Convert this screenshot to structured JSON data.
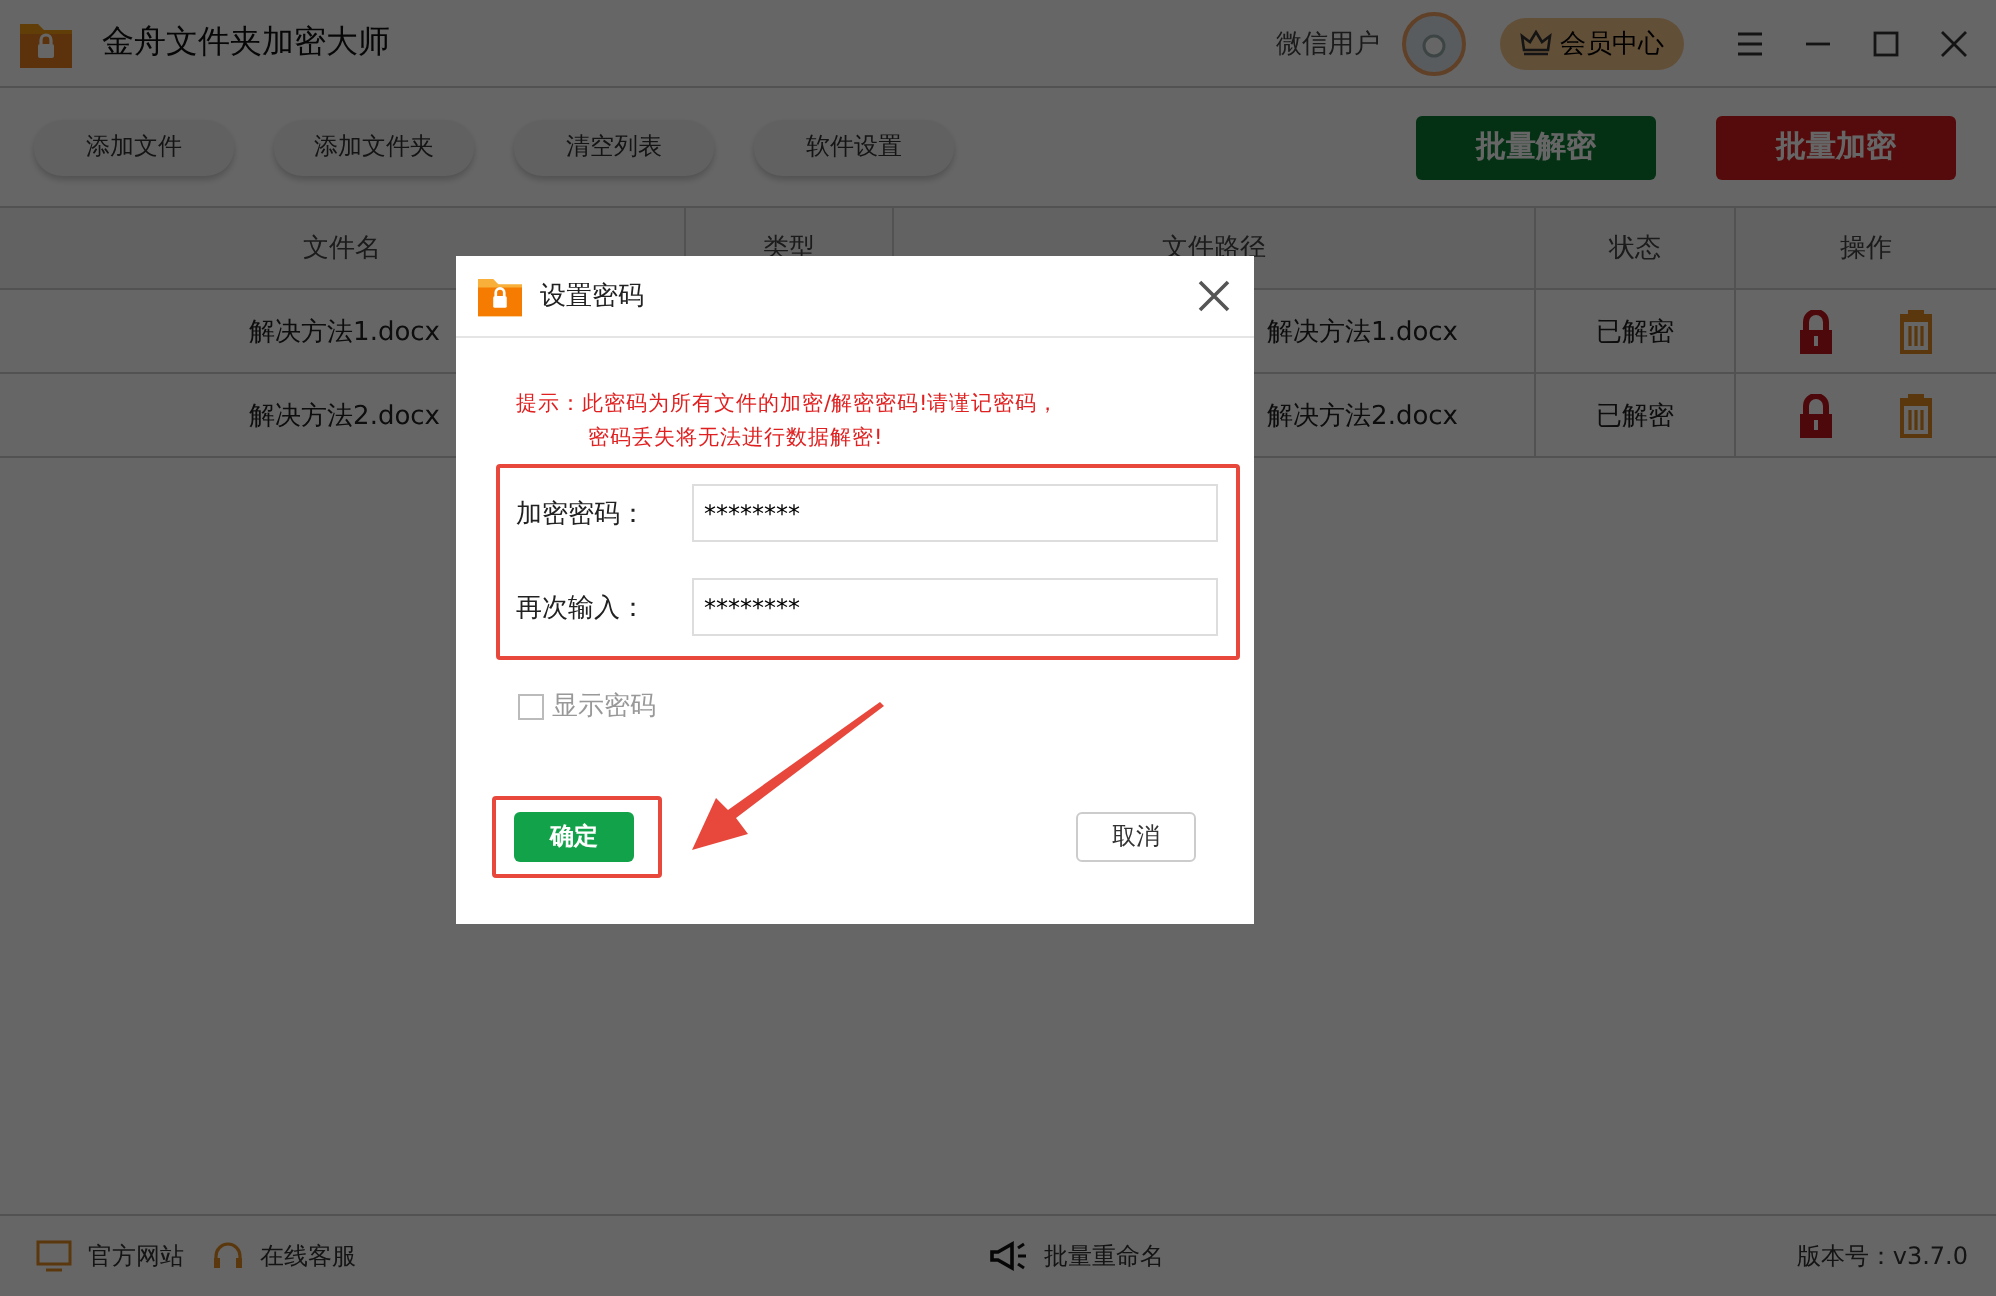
{
  "window": {
    "title": "金舟文件夹加密大师",
    "user": "微信用户",
    "vip_button": "会员中心"
  },
  "toolbar": {
    "buttons": [
      "添加文件",
      "添加文件夹",
      "清空列表",
      "软件设置"
    ],
    "actions": [
      {
        "label": "批量解密",
        "kind": "decrypt"
      },
      {
        "label": "批量加密",
        "kind": "encrypt"
      }
    ]
  },
  "table": {
    "columns": [
      "文件名",
      "类型",
      "文件路径",
      "状态",
      "操作"
    ],
    "rows": [
      {
        "name": "解决方法1.docx",
        "path": "解决方法1.docx",
        "status": "已解密"
      },
      {
        "name": "解决方法2.docx",
        "path": "解决方法2.docx",
        "status": "已解密"
      }
    ]
  },
  "dialog": {
    "title": "设置密码",
    "hint": [
      "提示：此密码为所有文件的加密/解密密码!请谨记密码，",
      "密码丢失将无法进行数据解密!"
    ],
    "fields": [
      {
        "label": "加密密码：",
        "value": "********"
      },
      {
        "label": "再次输入：",
        "value": "********"
      }
    ],
    "show_password": {
      "label": "显示密码",
      "checked": false
    },
    "ok": "确定",
    "cancel": "取消"
  },
  "status_bar": {
    "links": [
      {
        "label": "官方网站",
        "kind": "web"
      },
      {
        "label": "在线客服",
        "kind": "support"
      }
    ],
    "rename": "批量重命名",
    "version": "版本号：v3.7.0"
  }
}
